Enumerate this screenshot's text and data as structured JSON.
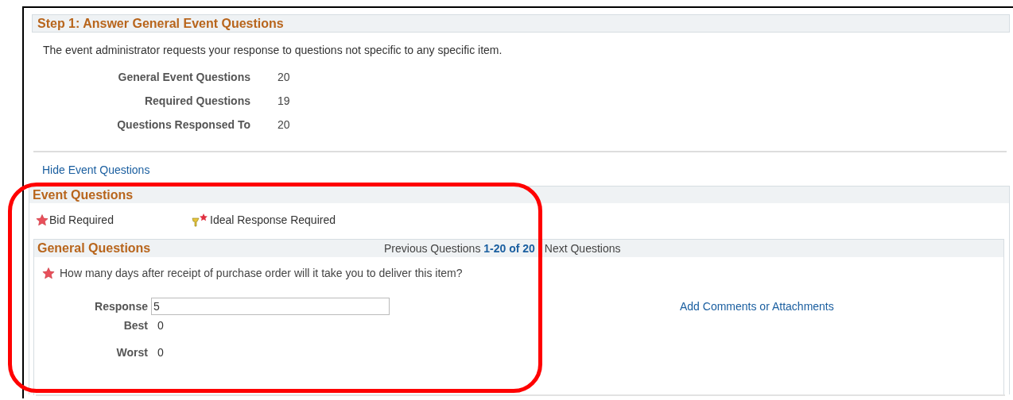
{
  "step": {
    "title": "Step 1: Answer General Event Questions",
    "description": "The event administrator requests your response to questions not specific to any specific item.",
    "stats": [
      {
        "label": "General Event Questions",
        "value": "20"
      },
      {
        "label": "Required Questions",
        "value": "19"
      },
      {
        "label": "Questions Responsed To",
        "value": "20"
      }
    ]
  },
  "hide_link": "Hide Event Questions",
  "event_questions": {
    "title": "Event Questions",
    "legend": [
      {
        "kind": "bid",
        "label": "Bid Required"
      },
      {
        "kind": "ideal",
        "label": "Ideal Response Required"
      }
    ],
    "general_questions": {
      "title": "General Questions",
      "pager": {
        "previous": "Previous Questions",
        "range": "1-20 of 20",
        "next": "Next Questions"
      },
      "question": {
        "required": true,
        "text": "How many days after receipt of purchase order will it take you to deliver this item?",
        "response_label": "Response",
        "response": "5",
        "best_label": "Best",
        "best": "0",
        "worst_label": "Worst",
        "worst": "0",
        "comments_link": "Add Comments or Attachments"
      }
    }
  },
  "annotation": {
    "kind": "highlight"
  }
}
